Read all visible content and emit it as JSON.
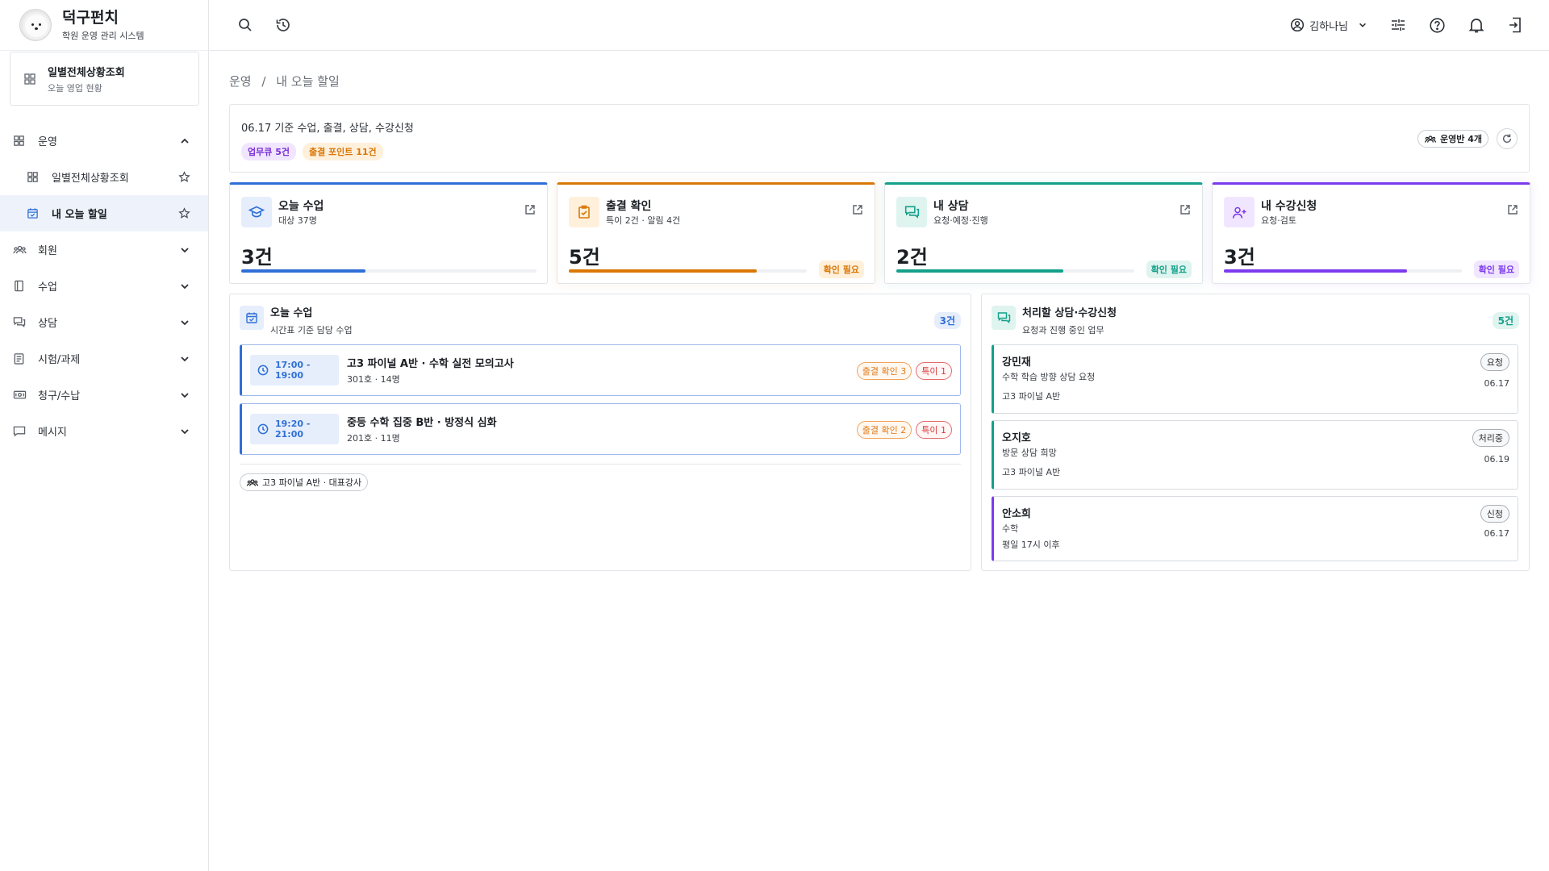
{
  "app": {
    "title": "덕구펀치",
    "subtitle": "학원 운영 관리 시스템"
  },
  "pinned": {
    "title": "일별전체상황조회",
    "subtitle": "오늘 영업 현황"
  },
  "sidebar": {
    "items": [
      {
        "label": "운영",
        "icon": "grid-icon"
      },
      {
        "label": "일별전체상황조회",
        "icon": "grid-icon"
      },
      {
        "label": "내 오늘 할일",
        "icon": "calendar-check-icon"
      },
      {
        "label": "회원",
        "icon": "users-icon"
      },
      {
        "label": "수업",
        "icon": "book-icon"
      },
      {
        "label": "상담",
        "icon": "chat-icon"
      },
      {
        "label": "시험/과제",
        "icon": "clipboard-icon"
      },
      {
        "label": "청구/수납",
        "icon": "money-icon"
      },
      {
        "label": "메시지",
        "icon": "message-icon"
      }
    ]
  },
  "header": {
    "user_name": "김하나님"
  },
  "breadcrumb": {
    "parent": "운영",
    "sep": "/",
    "current": "내 오늘 할일"
  },
  "summary": {
    "title": "06.17 기준 수업, 출결, 상담, 수강신청",
    "tag_queue": "업무큐 5건",
    "tag_points": "출결 포인트 11건",
    "classes_chip": "운영반 4개"
  },
  "stats": [
    {
      "title": "오늘 수업",
      "sub": "대상 37명",
      "value": "3건",
      "progress": 0.42,
      "badge": "",
      "color": "#2f6fd6"
    },
    {
      "title": "출결 확인",
      "sub": "특이 2건 · 알림 4건",
      "value": "5건",
      "progress": 0.79,
      "badge": "확인 필요",
      "color": "#d97706"
    },
    {
      "title": "내 상담",
      "sub": "요청·예정·진행",
      "value": "2건",
      "progress": 0.7,
      "badge": "확인 필요",
      "color": "#14a08a"
    },
    {
      "title": "내 수강신청",
      "sub": "요청·검토",
      "value": "3건",
      "progress": 0.77,
      "badge": "확인 필요",
      "color": "#7c3aed"
    }
  ],
  "today_panel": {
    "title": "오늘 수업",
    "subtitle": "시간표 기준 담당 수업",
    "count": "3건",
    "classes": [
      {
        "time": "17:00 -\n19:00",
        "title": "고3 파이널 A반 · 수학 실전 모의고사",
        "sub": "301호 · 14명",
        "attendance": "출결 확인 3",
        "special": "특이 1"
      },
      {
        "time": "19:20 -\n21:00",
        "title": "중등 수학 집중 B반 · 방정식 심화",
        "sub": "201호 · 11명",
        "attendance": "출결 확인 2",
        "special": "특이 1"
      }
    ],
    "class_chip": "고3 파이널 A반 · 대표강사"
  },
  "requests_panel": {
    "title": "처리할 상담·수강신청",
    "subtitle": "요청과 진행 중인 업무",
    "count": "5건",
    "items": [
      {
        "name": "강민재",
        "line1": "수학 학습 방향 상담 요청",
        "line2": "고3 파이널 A반",
        "status": "요청",
        "date": "06.17"
      },
      {
        "name": "오지호",
        "line1": "방문 상담 희망",
        "line2": "고3 파이널 A반",
        "status": "처리중",
        "date": "06.19"
      },
      {
        "name": "안소희",
        "line1": "수학",
        "line2": "평일 17시 이후",
        "status": "신청",
        "date": "06.17"
      }
    ]
  }
}
